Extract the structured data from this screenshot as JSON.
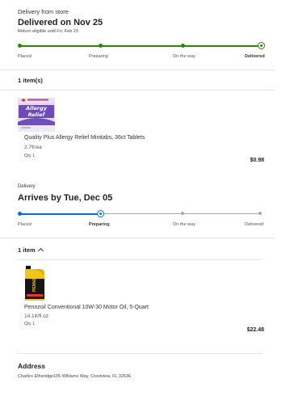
{
  "order1": {
    "source_label": "Delivery from store",
    "status_title": "Delivered on Nov 25",
    "return_note": "Return eligible until Fri, Feb 23",
    "progress": {
      "steps": [
        "Placed",
        "Preparing",
        "On the way",
        "Delivered"
      ],
      "current_step_index": 3,
      "color": "#2a8703"
    },
    "items_heading": "1 item(s)",
    "product": {
      "image_icon": "allergy-relief-box-icon",
      "image_text": "Allergy Relief",
      "name": "Quality Plus Allergy Relief Minitabs, 36ct Tablets",
      "unit_price": "2.7¢/ea",
      "qty": "Qty 1",
      "price": "$0.98"
    }
  },
  "order2": {
    "source_label": "Delivery",
    "status_title": "Arrives by Tue, Dec 05",
    "progress": {
      "steps": [
        "Placed",
        "Preparing",
        "On the way",
        "Delivered"
      ],
      "current_step_index": 1,
      "color": "#0071dc"
    },
    "items_heading": "1 item",
    "product": {
      "image_icon": "motor-oil-jug-icon",
      "image_text": "PENNZOIL",
      "name": "Pennzoil Conventional 10W-30 Motor Oil, 5-Quart",
      "unit_price": "14.1¢/fl oz",
      "qty": "Qty 1",
      "price": "$22.48"
    }
  },
  "address": {
    "title": "Address",
    "line": "Charles Etheridge105 Williams Way, Crestview, FL 32536"
  },
  "colors": {
    "inactive_track": "#a9a9a9",
    "divider": "#e3e3e3"
  }
}
